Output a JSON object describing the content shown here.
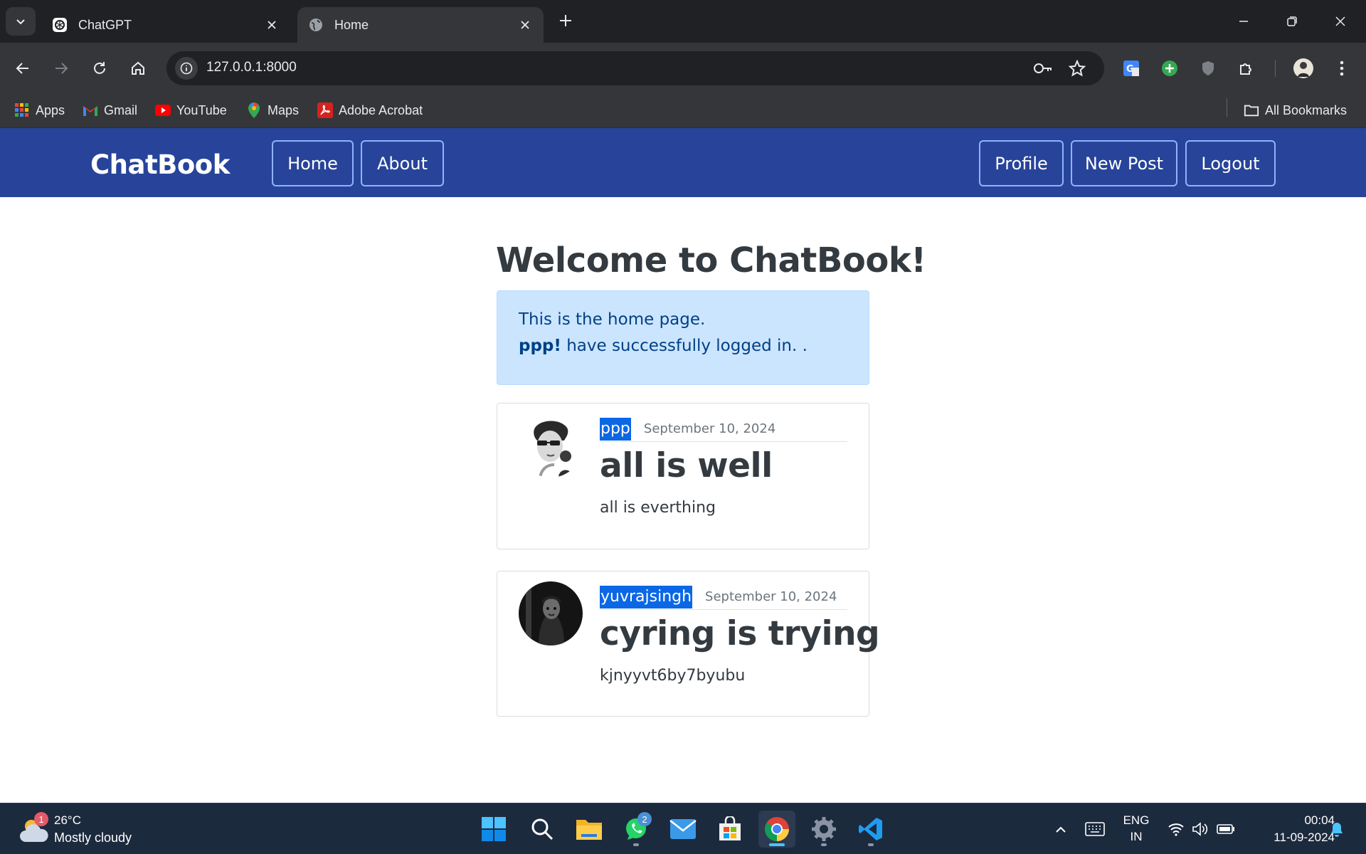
{
  "browser": {
    "tabs": [
      {
        "title": "ChatGPT",
        "active": false,
        "favicon": "chatgpt-icon"
      },
      {
        "title": "Home",
        "active": true,
        "favicon": "globe-icon"
      }
    ],
    "url": "127.0.0.1:8000",
    "bookmarks": [
      {
        "label": "Apps",
        "icon": "apps-grid-icon"
      },
      {
        "label": "Gmail",
        "icon": "gmail-icon"
      },
      {
        "label": "YouTube",
        "icon": "youtube-icon"
      },
      {
        "label": "Maps",
        "icon": "maps-icon"
      },
      {
        "label": "Adobe Acrobat",
        "icon": "acrobat-icon"
      }
    ],
    "all_bookmarks": "All Bookmarks"
  },
  "navbar": {
    "brand": "ChatBook",
    "left_links": [
      "Home",
      "About"
    ],
    "right_links": [
      "Profile",
      "New Post",
      "Logout"
    ]
  },
  "main": {
    "title": "Welcome to ChatBook!",
    "alert": {
      "line1": "This is the home page.",
      "user": "ppp!",
      "line2_rest": " have successfully logged in. ."
    },
    "posts": [
      {
        "author": "ppp",
        "date": "September 10, 2024",
        "title": "all is well",
        "body": "all is everthing"
      },
      {
        "author": "yuvrajsingh",
        "date": "September 10, 2024",
        "title": "cyring is trying",
        "body": "kjnyyvt6by7byubu"
      }
    ]
  },
  "taskbar": {
    "weather": {
      "temp": "26°C",
      "condition": "Mostly cloudy",
      "badge": "1"
    },
    "whatsapp_badge": "2",
    "language": {
      "lang": "ENG",
      "region": "IN"
    },
    "clock": {
      "time": "00:04",
      "date": "11-09-2024"
    }
  }
}
